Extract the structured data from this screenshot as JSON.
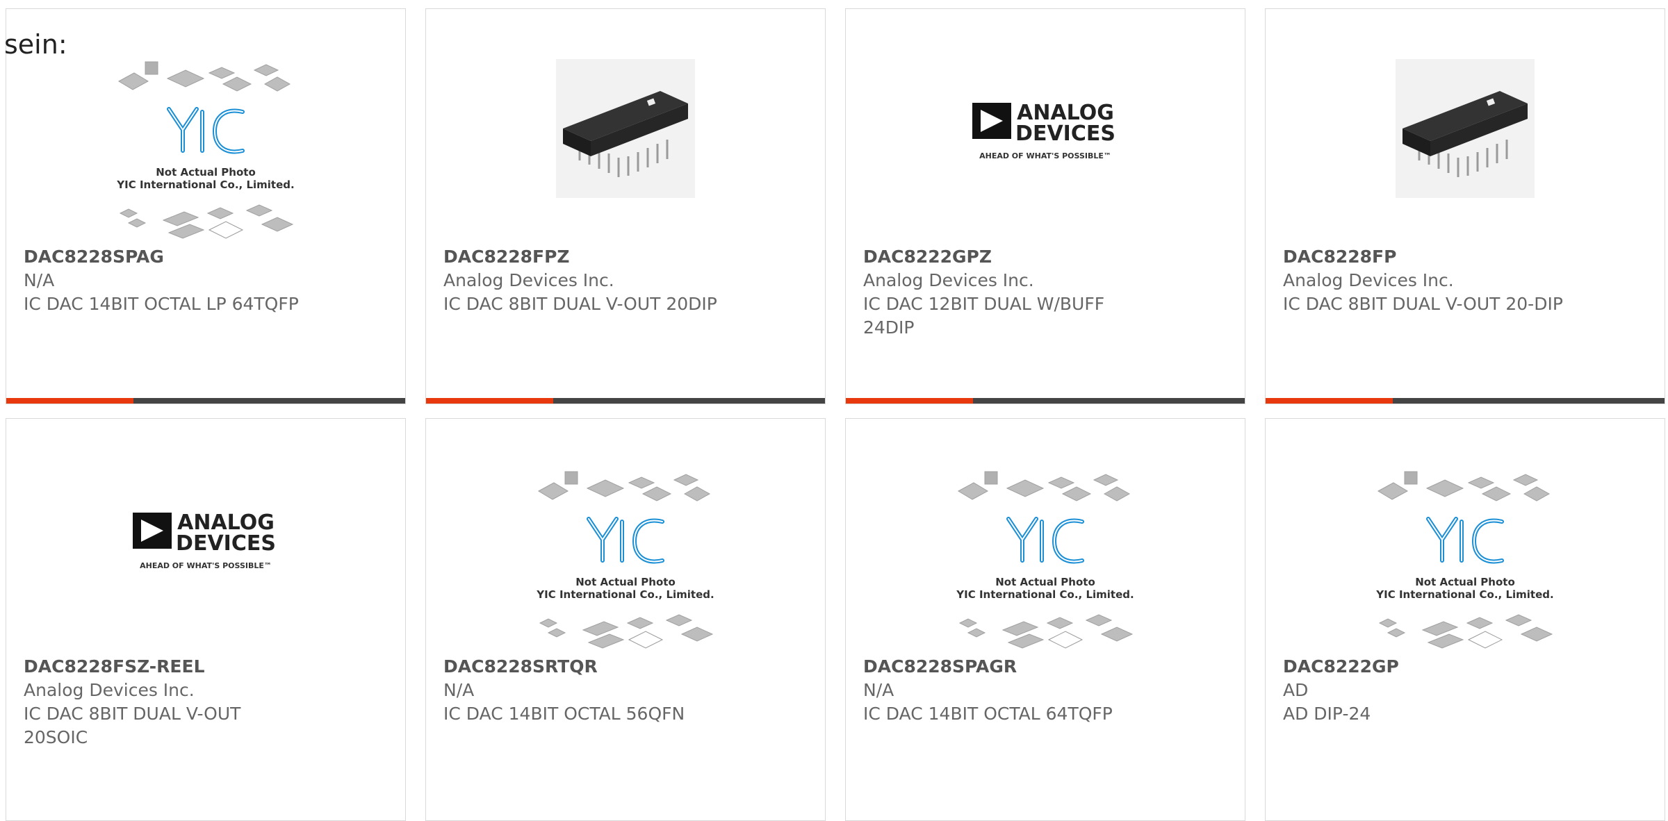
{
  "lead_text": "sein:",
  "colors": {
    "accent": "#e8380d",
    "bar": "#444444",
    "border": "#d9d9d9",
    "yic_blue": "#1a8fd6"
  },
  "placeholder_image": {
    "line1": "Not Actual Photo",
    "line2": "YIC International Co., Limited.",
    "logo": "YIC"
  },
  "analog_logo": {
    "line1": "ANALOG",
    "line2": "DEVICES",
    "tagline": "AHEAD OF WHAT'S POSSIBLE™"
  },
  "products": [
    {
      "part": "DAC8228SPAG",
      "manufacturer": "N/A",
      "description": "IC DAC 14BIT OCTAL LP 64TQFP",
      "image": "yic-placeholder-icon"
    },
    {
      "part": "DAC8228FPZ",
      "manufacturer": "Analog Devices Inc.",
      "description": "IC DAC 8BIT DUAL V-OUT 20DIP",
      "image": "dip-chip-photo-icon"
    },
    {
      "part": "DAC8222GPZ",
      "manufacturer": "Analog Devices Inc.",
      "description": "IC DAC 12BIT DUAL W/BUFF 24DIP",
      "image": "analog-devices-logo-icon"
    },
    {
      "part": "DAC8228FP",
      "manufacturer": "Analog Devices Inc.",
      "description": "IC DAC 8BIT DUAL V-OUT 20-DIP",
      "image": "dip-chip-photo-icon"
    },
    {
      "part": "DAC8228FSZ-REEL",
      "manufacturer": "Analog Devices Inc.",
      "description": "IC DAC 8BIT DUAL V-OUT 20SOIC",
      "image": "analog-devices-logo-icon"
    },
    {
      "part": "DAC8228SRTQR",
      "manufacturer": "N/A",
      "description": "IC DAC 14BIT OCTAL 56QFN",
      "image": "yic-placeholder-icon"
    },
    {
      "part": "DAC8228SPAGR",
      "manufacturer": "N/A",
      "description": "IC DAC 14BIT OCTAL 64TQFP",
      "image": "yic-placeholder-icon"
    },
    {
      "part": "DAC8222GP",
      "manufacturer": "AD",
      "description": "AD DIP-24",
      "image": "yic-placeholder-icon"
    }
  ]
}
